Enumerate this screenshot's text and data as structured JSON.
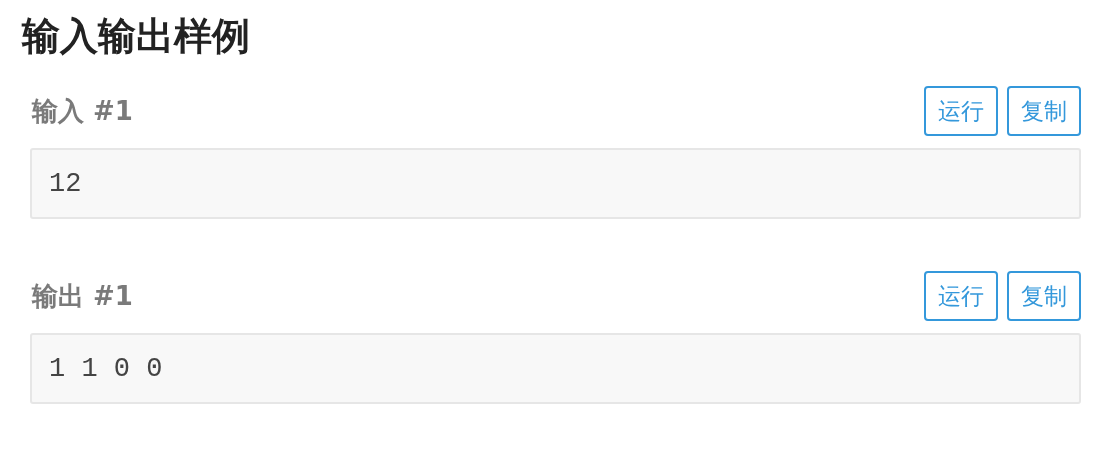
{
  "title": "输入输出样例",
  "samples": [
    {
      "label": "输入 #1",
      "buttons": [
        "运行",
        "复制"
      ],
      "content": "12"
    },
    {
      "label": "输出 #1",
      "buttons": [
        "运行",
        "复制"
      ],
      "content": "1 1 0 0"
    }
  ]
}
